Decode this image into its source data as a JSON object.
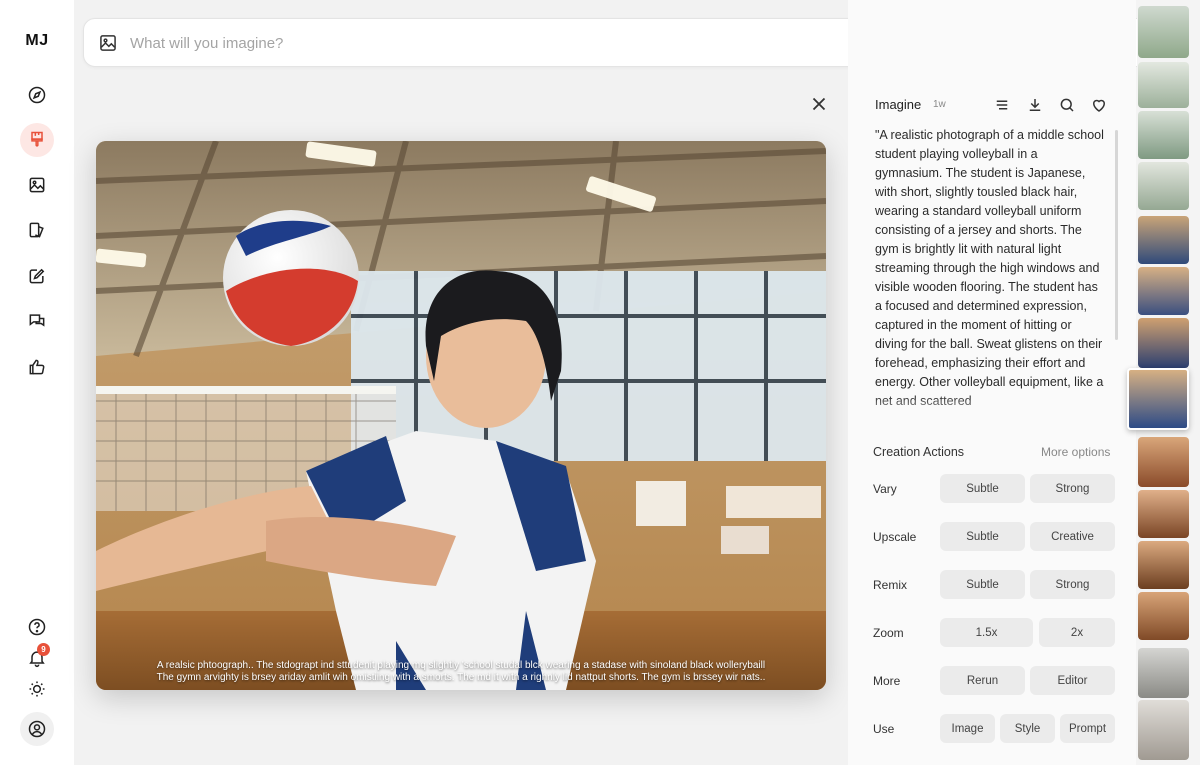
{
  "sidebar": {
    "logo": "MJ",
    "items": [
      {
        "name": "explore",
        "icon": "compass-icon"
      },
      {
        "name": "create",
        "icon": "paintbrush-icon",
        "active": true
      },
      {
        "name": "organize",
        "icon": "image-icon"
      },
      {
        "name": "edit",
        "icon": "edit-layers-icon"
      },
      {
        "name": "personalize",
        "icon": "pencil-square-icon"
      },
      {
        "name": "chat",
        "icon": "chat-bubbles-icon"
      },
      {
        "name": "rank",
        "icon": "thumbs-up-icon"
      }
    ],
    "bottom": [
      {
        "name": "help",
        "icon": "help-circle-icon"
      },
      {
        "name": "notifications",
        "icon": "bell-icon",
        "badge": "9"
      },
      {
        "name": "theme",
        "icon": "sun-icon"
      },
      {
        "name": "profile",
        "icon": "user-circle-icon"
      }
    ],
    "notification_count": "9"
  },
  "prompt_bar": {
    "placeholder": "What will you imagine?"
  },
  "search": {
    "placeholder": "Search"
  },
  "image": {
    "caption_line1": "A realsic phtoograph.. The stdograpt ind  sttudenit playing mq  slightly  'school studal blck  wearing  a stadase with sinoland black wollerybaill",
    "caption_line2": "The gymn arvighty is brsey ariday amlit wih omistiing with a smorts. The md  it with a  righnly lid  nattput shorts. The gym is brssey wir nats.."
  },
  "panel": {
    "title": "Imagine",
    "age": "1w",
    "prompt": "\"A realistic photograph of a middle school student playing volleyball in a gymnasium. The student is Japanese, with short, slightly tousled black hair, wearing a standard volleyball uniform consisting of a jersey and shorts. The gym is brightly lit with natural light streaming through the high windows and visible wooden flooring. The student has a focused and determined expression, captured in the moment of hitting or diving for the ball. Sweat glistens on their forehead, emphasizing their effort and energy. Other volleyball equipment, like a net and scattered",
    "section_title": "Creation Actions",
    "more_options": "More options",
    "rows": [
      {
        "label": "Vary",
        "buttons": [
          "Subtle",
          "Strong"
        ]
      },
      {
        "label": "Upscale",
        "buttons": [
          "Subtle",
          "Creative"
        ]
      },
      {
        "label": "Remix",
        "buttons": [
          "Subtle",
          "Strong"
        ]
      },
      {
        "label": "Zoom",
        "buttons": [
          "1.5x",
          "2x"
        ]
      },
      {
        "label": "More",
        "buttons": [
          "Rerun",
          "Editor"
        ]
      },
      {
        "label": "Use",
        "buttons": [
          "Image",
          "Style",
          "Prompt"
        ]
      }
    ]
  },
  "colors": {
    "accent": "#e8513a",
    "active_bg": "#fde7e4",
    "button_bg": "#ebebeb"
  }
}
